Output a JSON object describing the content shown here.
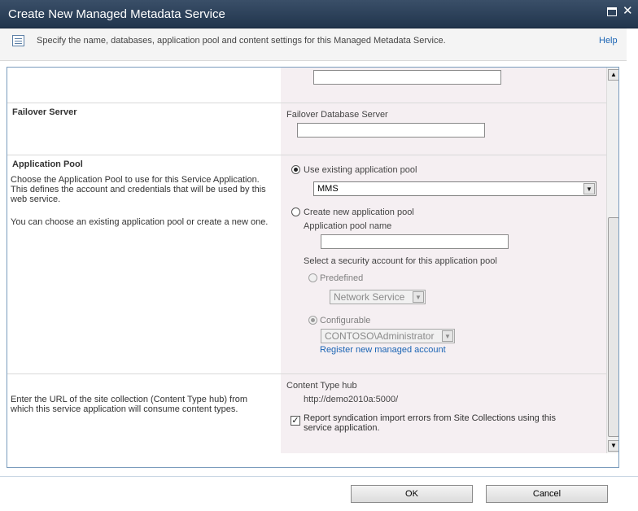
{
  "window": {
    "title": "Create New Managed Metadata Service",
    "description": "Specify the name, databases, application pool and content settings for this Managed Metadata Service.",
    "help_label": "Help"
  },
  "failover": {
    "title": "Failover Server",
    "field_label": "Failover Database Server",
    "field_value": ""
  },
  "app_pool": {
    "title": "Application Pool",
    "description_1": "Choose the Application Pool to use for this Service Application. This defines the account and credentials that will be used by this web service.",
    "description_2": "You can choose an existing application pool or create a new one.",
    "use_existing_label": "Use existing application pool",
    "existing_selected": "MMS",
    "create_new_label": "Create new application pool",
    "pool_name_label": "Application pool name",
    "pool_name_value": "",
    "security_label": "Select a security account for this application pool",
    "predefined_label": "Predefined",
    "predefined_selected": "Network Service",
    "configurable_label": "Configurable",
    "configurable_selected": "CONTOSO\\Administrator",
    "register_link": "Register new managed account"
  },
  "content_type_hub": {
    "description": "Enter the URL of the site collection (Content Type hub) from which this service application will consume content types.",
    "label": "Content Type hub",
    "url": "http://demo2010a:5000/",
    "report_errors_label": "Report syndication import errors from Site Collections using this service application.",
    "report_errors_checked": true
  },
  "buttons": {
    "ok": "OK",
    "cancel": "Cancel"
  },
  "colors": {
    "titlebar": "#2c4058",
    "right_pane": "#f5eff2",
    "link": "#1a64b4"
  }
}
